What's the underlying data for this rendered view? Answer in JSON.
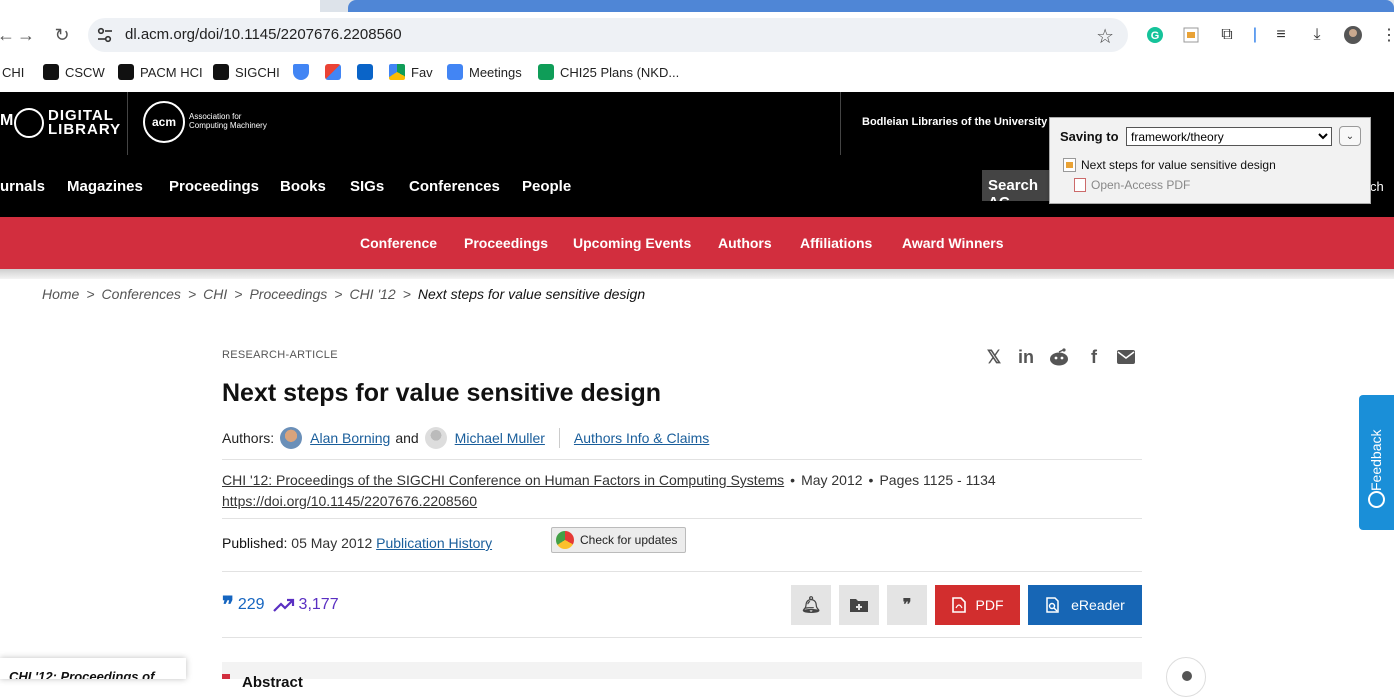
{
  "browser": {
    "url": "dl.acm.org/doi/10.1145/2207676.2208560",
    "bookmarks": [
      "CHI",
      "CSCW",
      "PACM HCI",
      "SIGCHI",
      "Fav",
      "Meetings",
      "CHI25 Plans (NKD..."
    ]
  },
  "header": {
    "dl_letters": "M",
    "dl_logo_text": "DIGITAL LIBRARY",
    "acm_circle": "acm",
    "acm_text": "Association for Computing Machinery",
    "institution": "Bodleian Libraries of the University of"
  },
  "nav": {
    "items": [
      "urnals",
      "Magazines",
      "Proceedings",
      "Books",
      "SIGs",
      "Conferences",
      "People"
    ],
    "search_label": "Search AC",
    "search_tail": "ch"
  },
  "subnav": {
    "items": [
      "Conference",
      "Proceedings",
      "Upcoming Events",
      "Authors",
      "Affiliations",
      "Award Winners"
    ]
  },
  "saving_popup": {
    "label": "Saving to",
    "folder": "framework/theory",
    "item_title": "Next steps for value sensitive design",
    "item_attachment": "Open-Access PDF"
  },
  "breadcrumb": {
    "items": [
      "Home",
      "Conferences",
      "CHI",
      "Proceedings",
      "CHI '12"
    ],
    "current": "Next steps for value sensitive design",
    "separator": ">"
  },
  "article": {
    "type": "RESEARCH-ARTICLE",
    "title": "Next steps for value sensitive design",
    "authors_label": "Authors:",
    "author1": "Alan Borning",
    "and": "and",
    "author2": "Michael Muller",
    "authors_info": "Authors Info & Claims",
    "proceedings": "CHI '12: Proceedings of the SIGCHI Conference on Human Factors in Computing Systems",
    "date": "May 2012",
    "pages": "Pages 1125 - 1134",
    "doi": "https://doi.org/10.1145/2207676.2208560",
    "published_label": "Published:",
    "published_date": "05 May 2012",
    "publication_history": "Publication History",
    "check_updates": "Check for updates",
    "citations": "229",
    "downloads": "3,177",
    "pdf_label": "PDF",
    "ereader_label": "eReader",
    "abstract_label": "Abstract"
  },
  "side_card": {
    "text": "CHI '12: Proceedings of"
  },
  "feedback": {
    "label": "Feedback"
  },
  "colors": {
    "acm_red": "#d22e3e",
    "link_blue": "#1a5e9b",
    "ereader_blue": "#1766b5",
    "feedback_blue": "#1a8fd8"
  }
}
